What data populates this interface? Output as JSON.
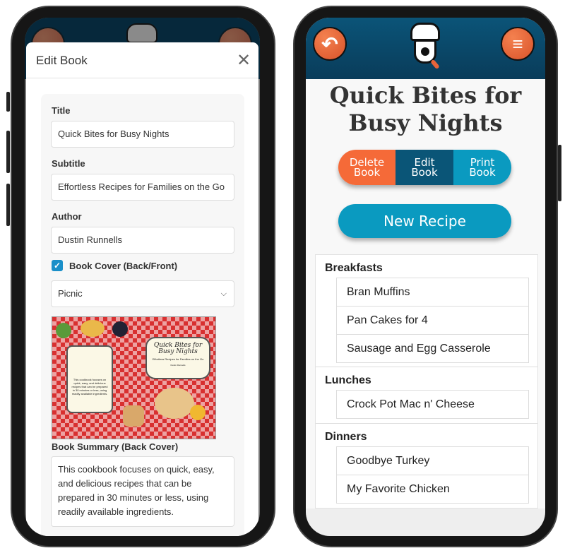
{
  "left_phone": {
    "modal": {
      "title": "Edit Book",
      "close_icon": "close-icon",
      "fields": {
        "title_label": "Title",
        "title_value": "Quick Bites for Busy Nights",
        "subtitle_label": "Subtitle",
        "subtitle_value": "Effortless Recipes for Families on the Go",
        "author_label": "Author",
        "author_value": "Dustin Runnells",
        "cover_checkbox_label": "Book Cover (Back/Front)",
        "cover_checked": true,
        "cover_theme": "Picnic",
        "summary_label": "Book Summary (Back Cover)",
        "summary_value": "This cookbook focuses on quick, easy, and delicious recipes that can be prepared in 30 minutes or less, using readily available ingredients."
      },
      "cover_image": {
        "title": "Quick Bites for Busy Nights",
        "subtitle": "Effortless Recipes for Families on the Go",
        "author": "Dustin Runnells",
        "back_text": "This cookbook focuses on quick, easy, and delicious recipes that can be prepared in 30 minutes or less, using readily available ingredients."
      }
    }
  },
  "right_phone": {
    "header": {
      "back_icon": "back-arrow-icon",
      "logo": "chef-eye-logo",
      "menu_icon": "hamburger-menu-icon"
    },
    "book_title": "Quick Bites for Busy Nights",
    "actions": {
      "delete": "Delete Book",
      "edit": "Edit Book",
      "print": "Print Book",
      "new_recipe": "New Recipe"
    },
    "sections": [
      {
        "name": "Breakfasts",
        "recipes": [
          "Bran Muffins",
          "Pan Cakes for 4",
          "Sausage and Egg Casserole"
        ]
      },
      {
        "name": "Lunches",
        "recipes": [
          "Crock Pot Mac n' Cheese"
        ]
      },
      {
        "name": "Dinners",
        "recipes": [
          "Goodbye Turkey",
          "My Favorite Chicken"
        ]
      }
    ],
    "colors": {
      "orange": "#f26a3a",
      "navy": "#0a5577",
      "teal": "#0a9ac0"
    }
  }
}
